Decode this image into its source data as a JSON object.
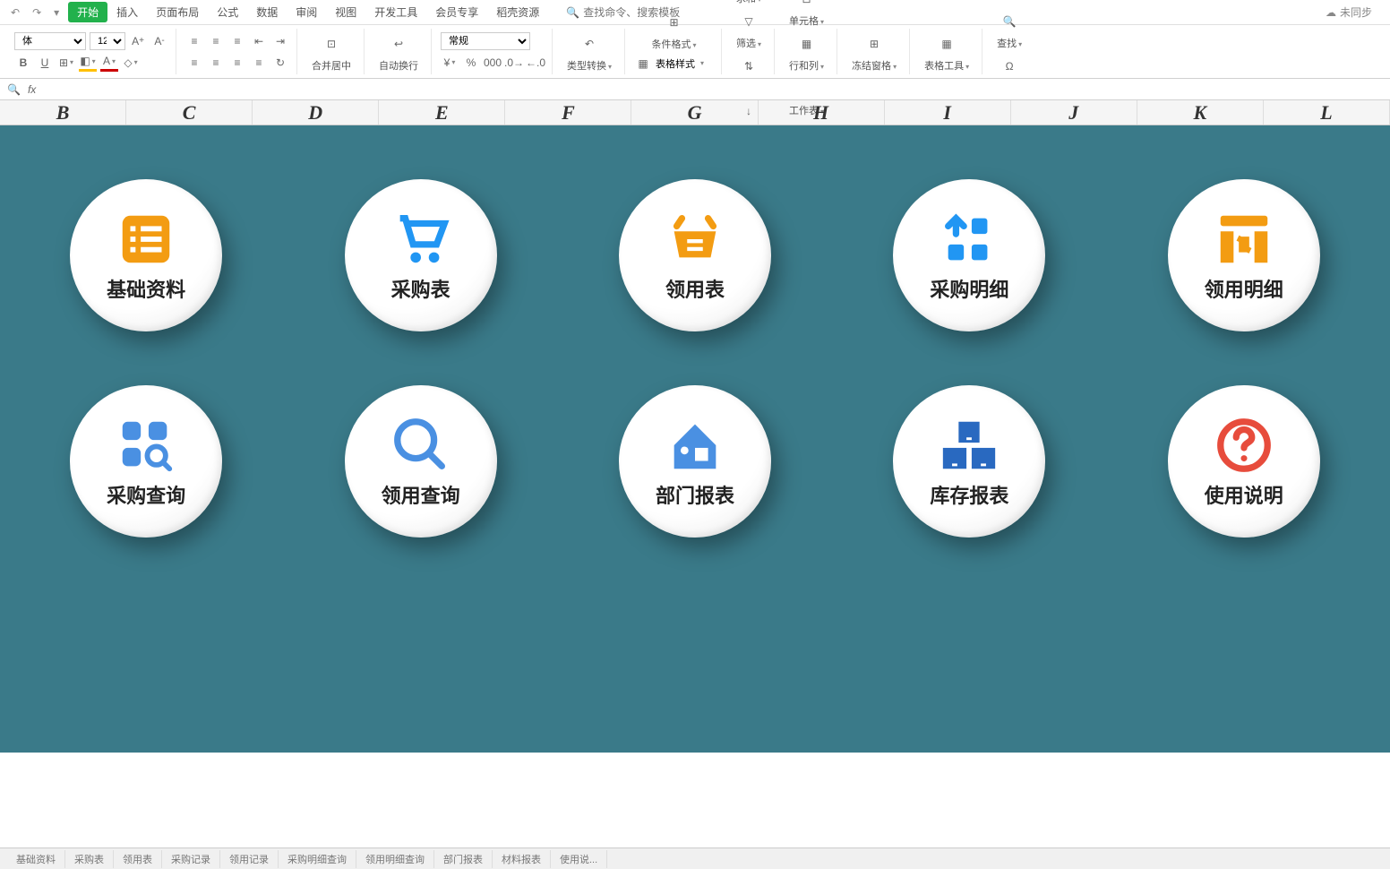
{
  "qat": {
    "undo": "↶",
    "redo": "↷"
  },
  "tabs": {
    "active": "开始",
    "items": [
      "开始",
      "插入",
      "页面布局",
      "公式",
      "数据",
      "审阅",
      "视图",
      "开发工具",
      "会员专享",
      "稻壳资源"
    ]
  },
  "search": {
    "placeholder": "查找命令、搜索模板"
  },
  "sync": {
    "label": "未同步"
  },
  "ribbon": {
    "font_name": "体",
    "font_size": "12",
    "merge": "合并居中",
    "wrap": "自动换行",
    "format_name": "常规",
    "type_convert": "类型转换",
    "cond_format": "条件格式",
    "table_style": "表格样式",
    "cell_style": "单元格样式",
    "sum": "求和",
    "filter": "筛选",
    "sort": "排序",
    "fill": "填充",
    "cell": "单元格",
    "rowcol": "行和列",
    "sheet": "工作表",
    "freeze": "冻结窗格",
    "table_tool": "表格工具",
    "find": "查找",
    "symbol": "符号"
  },
  "columns": [
    "B",
    "C",
    "D",
    "E",
    "F",
    "G",
    "H",
    "I",
    "J",
    "K",
    "L"
  ],
  "bubbles_row1": [
    {
      "label": "基础资料",
      "icon": "list"
    },
    {
      "label": "采购表",
      "icon": "cart"
    },
    {
      "label": "领用表",
      "icon": "basket"
    },
    {
      "label": "采购明细",
      "icon": "grid-up"
    },
    {
      "label": "领用明细",
      "icon": "columns"
    }
  ],
  "bubbles_row2": [
    {
      "label": "采购查询",
      "icon": "apps-search"
    },
    {
      "label": "领用查询",
      "icon": "magnify"
    },
    {
      "label": "部门报表",
      "icon": "house"
    },
    {
      "label": "库存报表",
      "icon": "boxes"
    },
    {
      "label": "使用说明",
      "icon": "question"
    }
  ],
  "sheets": [
    "基础资料",
    "采购表",
    "领用表",
    "采购记录",
    "领用记录",
    "采购明细查询",
    "领用明细查询",
    "部门报表",
    "材料报表",
    "使用说..."
  ]
}
